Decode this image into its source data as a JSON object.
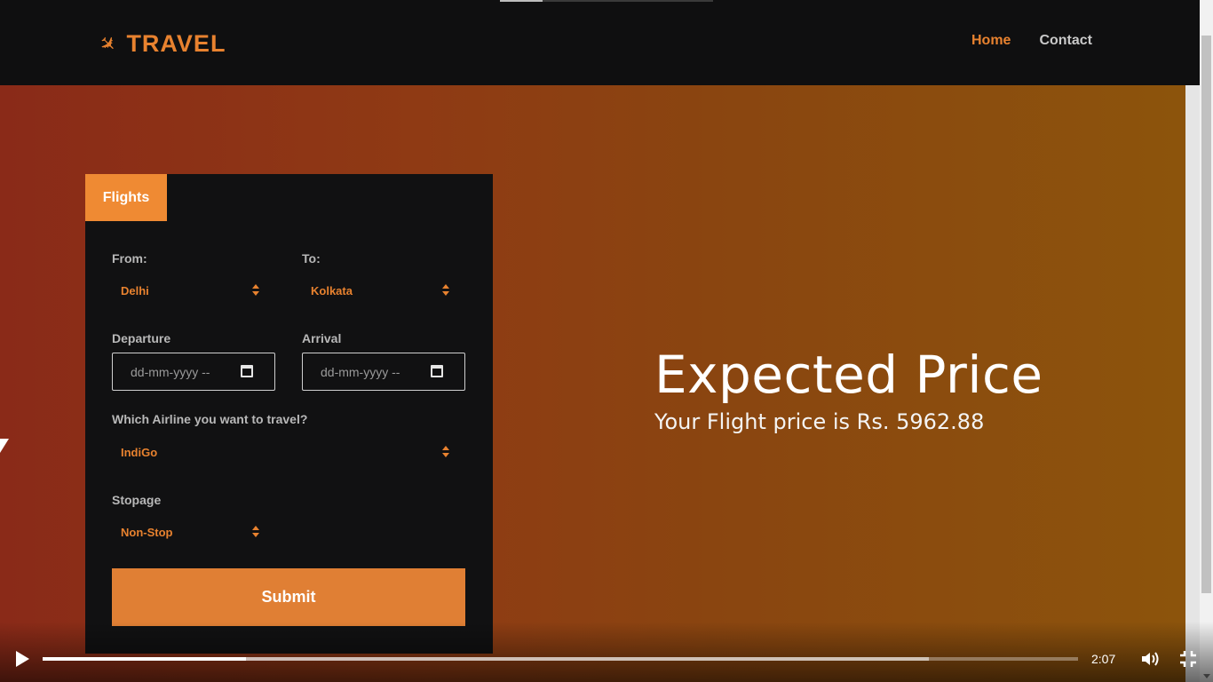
{
  "navbar": {
    "brand": "TRAVEL",
    "links": [
      {
        "label": "Home",
        "active": true
      },
      {
        "label": "Contact",
        "active": false
      }
    ]
  },
  "form": {
    "tab_label": "Flights",
    "from_label": "From:",
    "from_value": "Delhi",
    "to_label": "To:",
    "to_value": "Kolkata",
    "departure_label": "Departure",
    "departure_placeholder": "dd-mm-yyyy --",
    "arrival_label": "Arrival",
    "arrival_placeholder": "dd-mm-yyyy --",
    "airline_label": "Which Airline you want to travel?",
    "airline_value": "IndiGo",
    "stopage_label": "Stopage",
    "stopage_value": "Non-Stop",
    "submit_label": "Submit"
  },
  "result": {
    "title": "Expected Price",
    "price_text": "Your Flight price is Rs. 5962.88"
  },
  "video": {
    "time": "2:07",
    "progress_fraction": 0.196,
    "buffered_fraction": 0.856
  },
  "colors": {
    "accent": "#e8822f",
    "card_bg": "#111112",
    "nav_bg": "#0f0f10"
  }
}
